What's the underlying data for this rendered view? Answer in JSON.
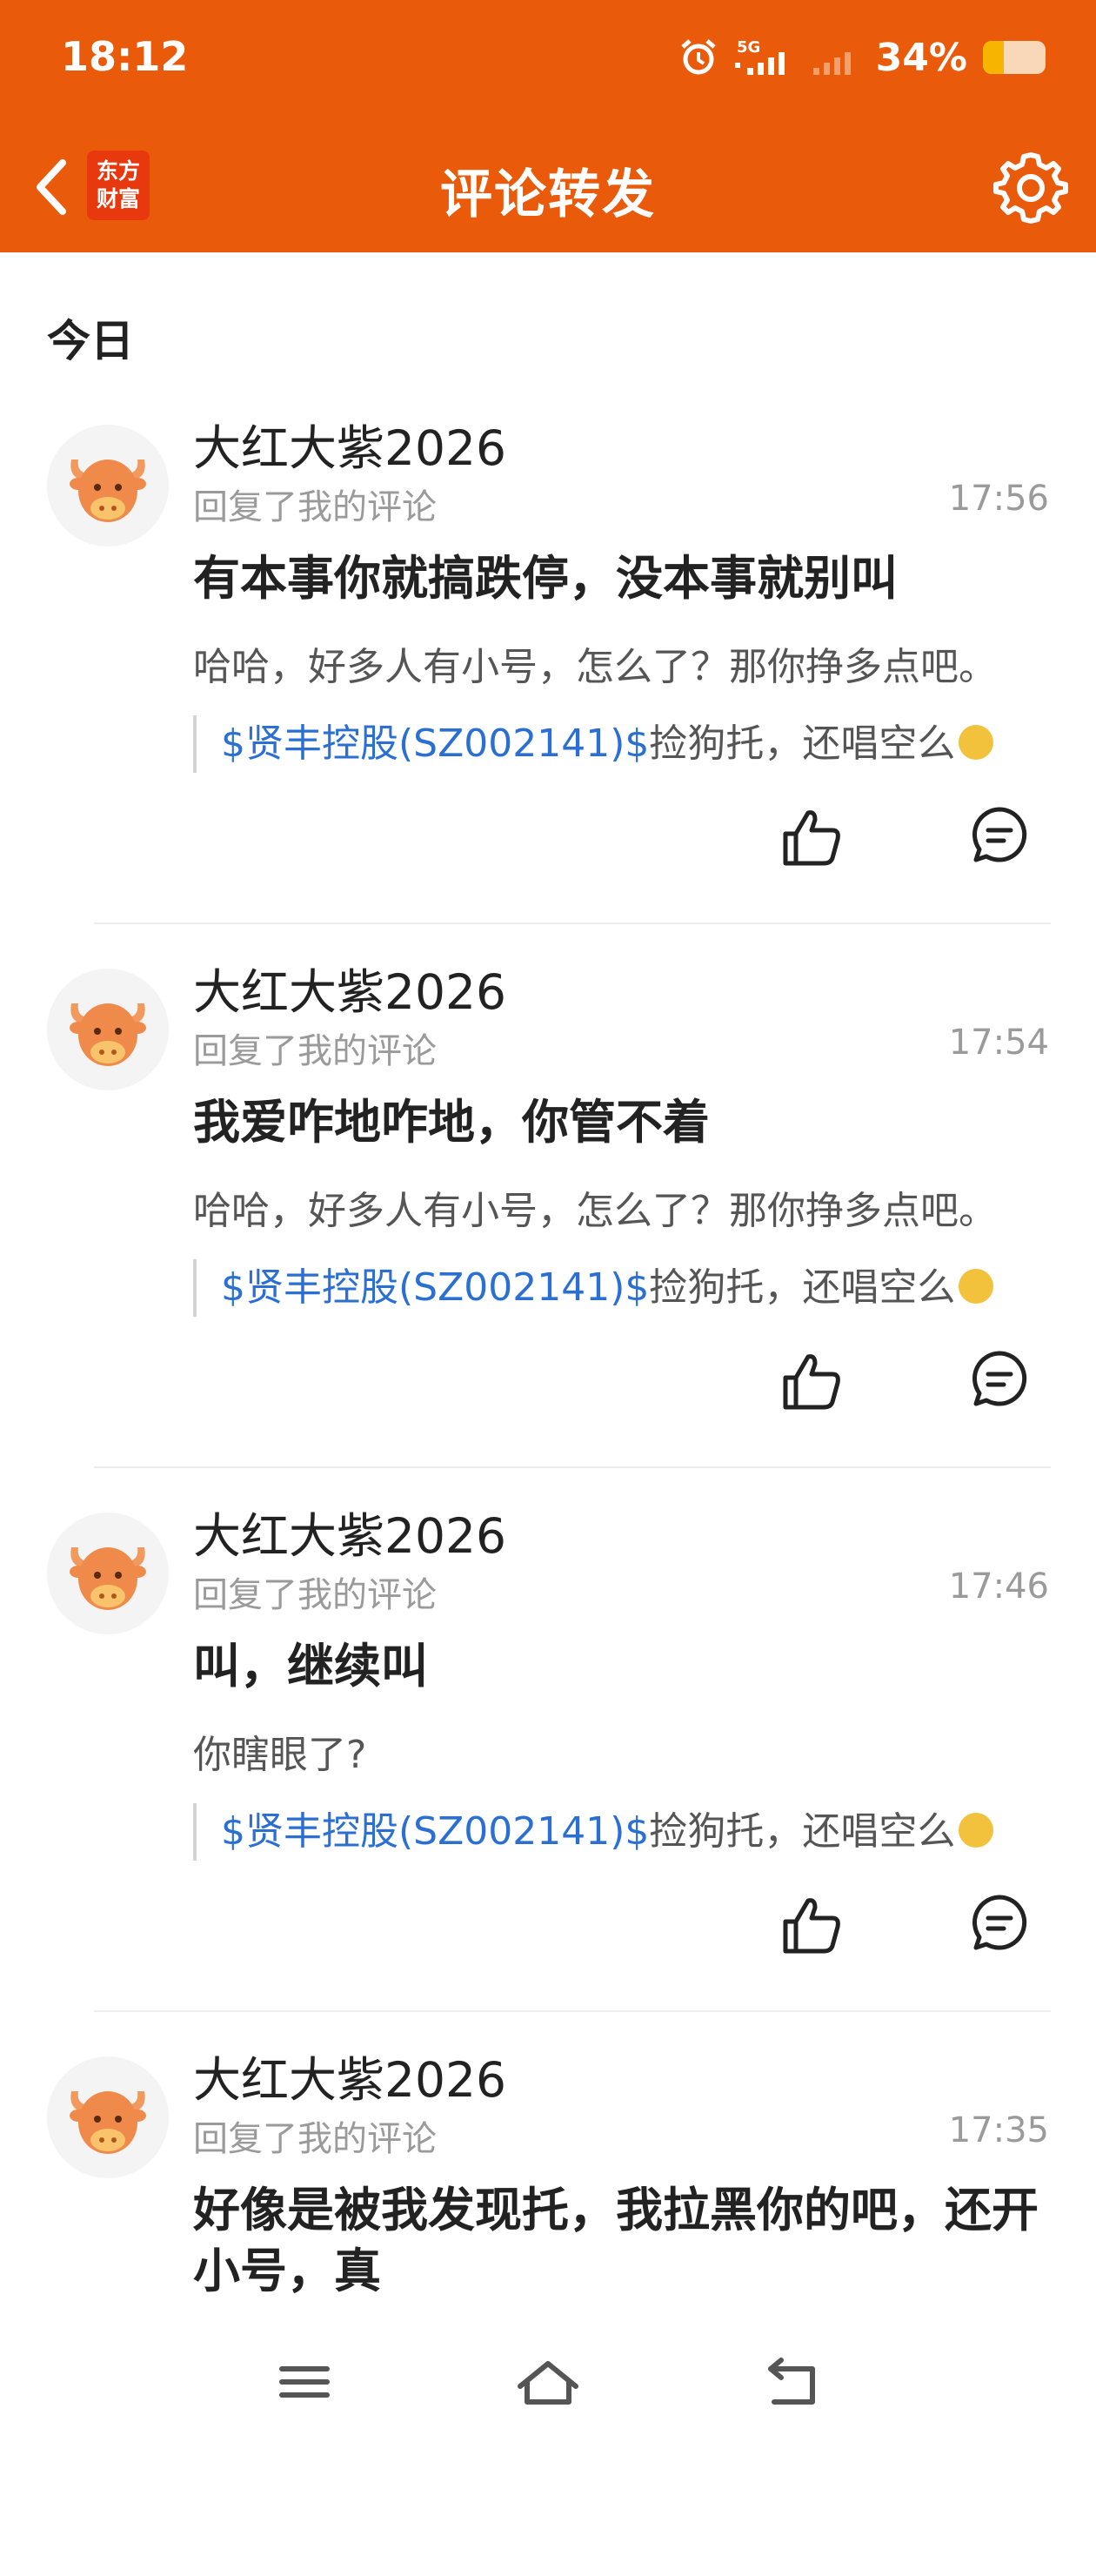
{
  "status_bar": {
    "time": "18:12",
    "network": "5G",
    "battery_percent": "34%",
    "battery_level": 0.34,
    "icons": [
      "alarm-icon",
      "signal-5g-icon",
      "signal-icon",
      "battery-icon"
    ]
  },
  "header": {
    "back_icon": "chevron-left-icon",
    "logo_line1": "东方",
    "logo_line2": "财富",
    "title": "评论转发",
    "settings_icon": "gear-icon",
    "bg_color": "#ea5a0b"
  },
  "section": {
    "label": "今日"
  },
  "notifications": [
    {
      "username": "大红大紫2026",
      "action": "回复了我的评论",
      "time": "17:56",
      "reply": "有本事你就搞跌停，没本事就别叫",
      "quote": "哈哈，好多人有小号，怎么了？那你挣多点吧。",
      "orig_stock": "$贤丰控股(SZ002141)$",
      "orig_text": "捡狗托，还唱空么"
    },
    {
      "username": "大红大紫2026",
      "action": "回复了我的评论",
      "time": "17:54",
      "reply": "我爱咋地咋地，你管不着",
      "quote": "哈哈，好多人有小号，怎么了？那你挣多点吧。",
      "orig_stock": "$贤丰控股(SZ002141)$",
      "orig_text": "捡狗托，还唱空么"
    },
    {
      "username": "大红大紫2026",
      "action": "回复了我的评论",
      "time": "17:46",
      "reply": "叫，继续叫",
      "quote": "你瞎眼了?",
      "orig_stock": "$贤丰控股(SZ002141)$",
      "orig_text": "捡狗托，还唱空么"
    },
    {
      "username": "大红大紫2026",
      "action": "回复了我的评论",
      "time": "17:35",
      "reply": "好像是被我发现托，我拉黑你的吧，还开小号，真"
    }
  ],
  "colors": {
    "accent": "#ea5a0b",
    "stock_link": "#2a6fd1",
    "muted": "#9a9a9a"
  }
}
